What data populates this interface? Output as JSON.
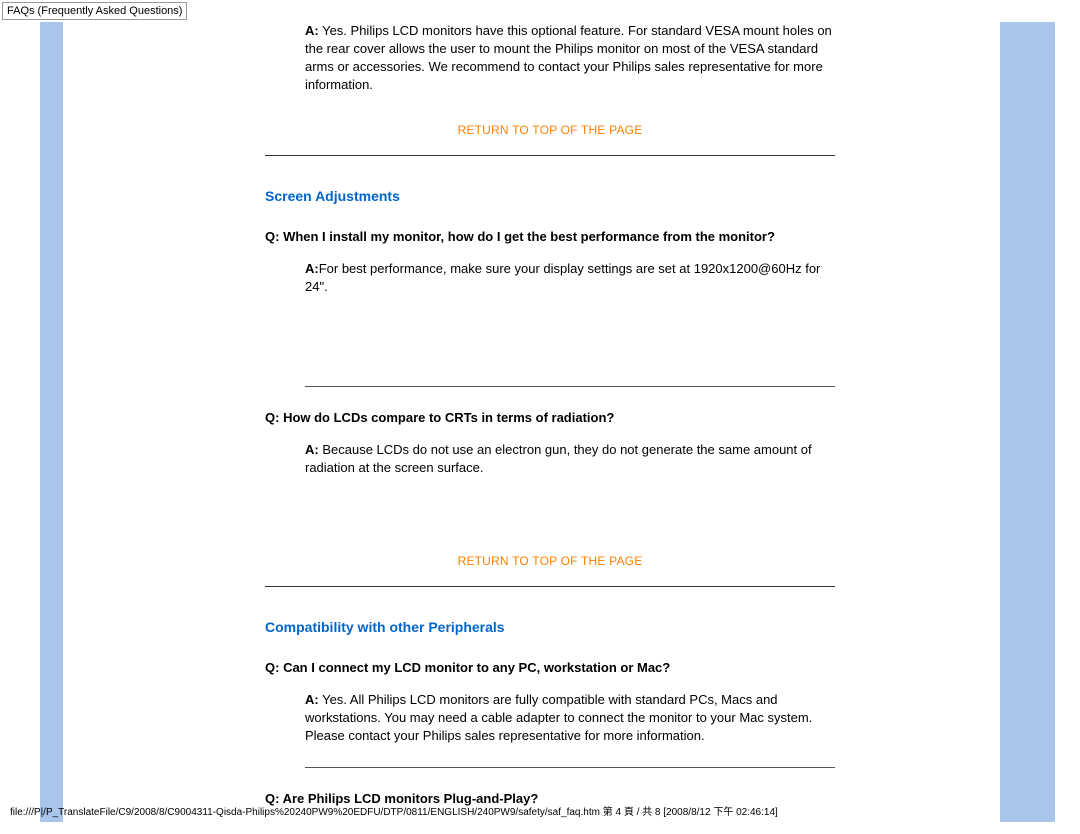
{
  "header": "FAQs (Frequently Asked Questions)",
  "top_answer": {
    "label": "A:",
    "text": " Yes. Philips LCD monitors have this optional feature. For standard VESA mount holes on the rear cover allows the user to mount the Philips monitor on most of the VESA standard arms or accessories. We recommend to contact your Philips sales representative for more information."
  },
  "return_link": "RETURN TO TOP OF THE PAGE",
  "section1": {
    "title": "Screen Adjustments",
    "q1": {
      "label": "Q:",
      "text": " When I install my monitor, how do I get the best performance from the monitor?"
    },
    "a1": {
      "label": "A:",
      "text": "For best performance, make sure your display settings are set at 1920x1200@60Hz for 24\"."
    },
    "q2": {
      "label": "Q:",
      "text": " How do LCDs compare to CRTs in terms of radiation?"
    },
    "a2": {
      "label": "A:",
      "text": " Because LCDs do not use an electron gun, they do not generate the same amount of radiation at the screen surface."
    }
  },
  "section2": {
    "title": "Compatibility with other Peripherals",
    "q1": {
      "label": "Q:",
      "text": " Can I connect my LCD monitor to any PC, workstation or Mac?"
    },
    "a1": {
      "label": "A:",
      "text": " Yes. All Philips LCD monitors are fully compatible with standard PCs, Macs and workstations. You may need a cable adapter to connect the monitor to your Mac system. Please contact your Philips sales representative for more information."
    },
    "q2": {
      "label": "Q:",
      "text": " Are Philips LCD monitors Plug-and-Play?"
    }
  },
  "footer": "file:///P|/P_TranslateFile/C9/2008/8/C9004311-Qisda-Philips%20240PW9%20EDFU/DTP/0811/ENGLISH/240PW9/safety/saf_faq.htm 第 4 頁 / 共 8  [2008/8/12 下午 02:46:14]"
}
